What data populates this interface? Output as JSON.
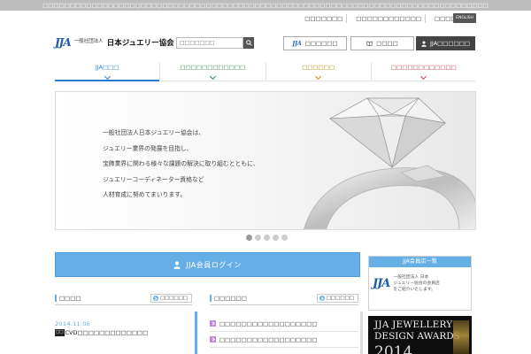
{
  "top_notice": "□□□□□□□□□□□□□□□□□□□□□□□□□□□□□□□□□□□□□□□□□□□□□□□□□□□□□□□□□□□□□□□□□□□□□□□□□□□□□□□□□□",
  "utility_links": [
    "□□□□□□□",
    "□□□□□□□□□□□□",
    "□□□□□□□"
  ],
  "language_button": "ENGLISH",
  "logo": {
    "mark": "JJA",
    "small": "一般社団法人",
    "name": "日本ジュエリー協会"
  },
  "search": {
    "placeholder": "□□□□□□□",
    "icon": "search-icon"
  },
  "header_buttons": [
    {
      "label": "□□□□□□",
      "icon": "jja-logo-icon"
    },
    {
      "label": "□□□□",
      "icon": "book-icon"
    },
    {
      "label": "JJA□□□□□□",
      "icon": "user-icon"
    }
  ],
  "global_nav": [
    {
      "label": "JJA□□□",
      "color": "#2a7bd0"
    },
    {
      "label": "□□□□□□□□□□□□",
      "color": "#2f8a3c"
    },
    {
      "label": "□□□□□□",
      "color": "#c28b0e"
    },
    {
      "label": "□□□□□□□□□□□□",
      "color": "#c23c3c"
    }
  ],
  "hero": {
    "lines": [
      "一般社団法人日本ジュエリー協会は、",
      "ジュエリー業界の発展を目指し、",
      "宝飾業界に関わる様々な課題の解決に取り組むとともに、",
      "ジュエリーコーディネーター資格など",
      "人材育成に努めてまいります。"
    ]
  },
  "carousel": {
    "total": 5,
    "active_index": 1
  },
  "login_button": "JJA会員ログイン",
  "news": {
    "heading": "□□□□",
    "more": "□□□□□□",
    "items": [
      {
        "date": "2014.11.06",
        "category": "□□",
        "title": "CVD□□□□□□□□□□□□□"
      }
    ]
  },
  "notices": {
    "heading": "□□□□□□",
    "more": "□□□□□□",
    "items": [
      "□□□□□□□□□□□□□□□□□□",
      "□□□□□□□□□□□□□□□□□□"
    ]
  },
  "member_box": {
    "heading": "JJA会員店一覧",
    "text_lines": [
      "一般社団法人 日本",
      "ジュエリー協会の会員店",
      "をご紹介いたします。"
    ]
  },
  "award_banner": {
    "line1": "JJA JEWELLERY",
    "line2": "DESIGN AWARDS",
    "line3": "2014"
  },
  "colors": {
    "accent": "#66aee6",
    "brand": "#1e5ba8",
    "dark_button": "#444444"
  }
}
